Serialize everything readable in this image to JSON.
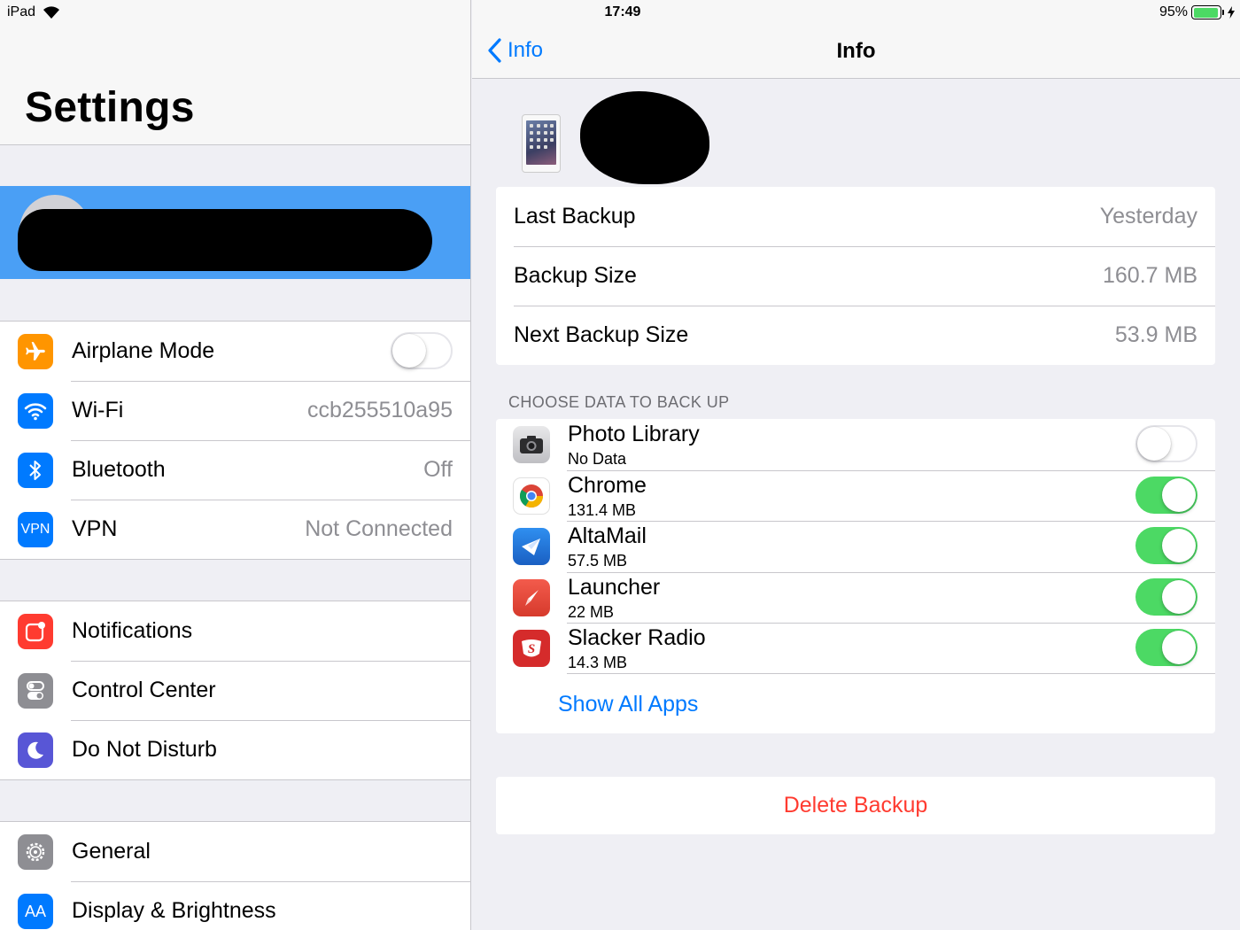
{
  "status_bar": {
    "device": "iPad",
    "time": "17:49",
    "battery": "95%",
    "battery_level": 0.95
  },
  "left_pane": {
    "title": "Settings",
    "group1": [
      {
        "label": "Airplane Mode",
        "icon": "airplane-icon",
        "color": "#ff9500",
        "toggle": "off"
      },
      {
        "label": "Wi-Fi",
        "icon": "wifi-icon",
        "color": "#007aff",
        "value": "ccb255510a95"
      },
      {
        "label": "Bluetooth",
        "icon": "bluetooth-icon",
        "color": "#007aff",
        "value": "Off"
      },
      {
        "label": "VPN",
        "icon": "vpn-icon",
        "icon_text": "VPN",
        "color": "#007aff",
        "value": "Not Connected"
      }
    ],
    "group2": [
      {
        "label": "Notifications",
        "icon": "notifications-icon",
        "color": "#ff3b30"
      },
      {
        "label": "Control Center",
        "icon": "control-center-icon",
        "color": "#8e8e93"
      },
      {
        "label": "Do Not Disturb",
        "icon": "moon-icon",
        "color": "#5856d6"
      }
    ],
    "group3": [
      {
        "label": "General",
        "icon": "gear-icon",
        "color": "#8e8e93"
      },
      {
        "label": "Display & Brightness",
        "icon": "display-icon",
        "icon_text": "AA",
        "color": "#007aff"
      }
    ]
  },
  "right_pane": {
    "nav": {
      "back_label": "Info",
      "title": "Info"
    },
    "backup_info": [
      {
        "label": "Last Backup",
        "value": "Yesterday"
      },
      {
        "label": "Backup Size",
        "value": "160.7 MB"
      },
      {
        "label": "Next Backup Size",
        "value": "53.9 MB"
      }
    ],
    "section_header": "CHOOSE DATA TO BACK UP",
    "apps": [
      {
        "name": "Photo Library",
        "size": "No Data",
        "icon": "camera-icon",
        "enabled": false
      },
      {
        "name": "Chrome",
        "size": "131.4 MB",
        "icon": "chrome-icon",
        "enabled": true
      },
      {
        "name": "AltaMail",
        "size": "57.5 MB",
        "icon": "altamail-icon",
        "enabled": true
      },
      {
        "name": "Launcher",
        "size": "22 MB",
        "icon": "launcher-icon",
        "enabled": true
      },
      {
        "name": "Slacker Radio",
        "size": "14.3 MB",
        "icon": "slacker-radio-icon",
        "enabled": true
      }
    ],
    "show_all": "Show All Apps",
    "delete": "Delete Backup"
  }
}
